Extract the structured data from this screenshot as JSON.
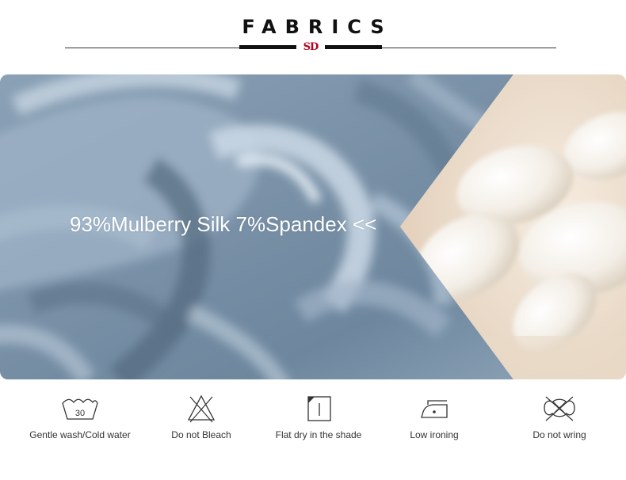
{
  "header": {
    "title": "FABRICS",
    "logo_text": "SD"
  },
  "hero": {
    "caption": "93%Mulberry Silk 7%Spandex <<",
    "colors": {
      "silk": "#7f97ad",
      "silk_light": "#b9c9d8",
      "silk_dark": "#536b80",
      "cocoon_bg": "#efe3d3",
      "cocoon": "#f7f4ee"
    }
  },
  "care": [
    {
      "icon": "wash-30-icon",
      "wash_temp": "30",
      "label": "Gentle wash/Cold water"
    },
    {
      "icon": "no-bleach-icon",
      "label": "Do not Bleach"
    },
    {
      "icon": "flat-dry-shade-icon",
      "label": "Flat dry in the shade"
    },
    {
      "icon": "low-iron-icon",
      "label": "Low ironing"
    },
    {
      "icon": "no-wring-icon",
      "label": "Do not wring"
    }
  ]
}
